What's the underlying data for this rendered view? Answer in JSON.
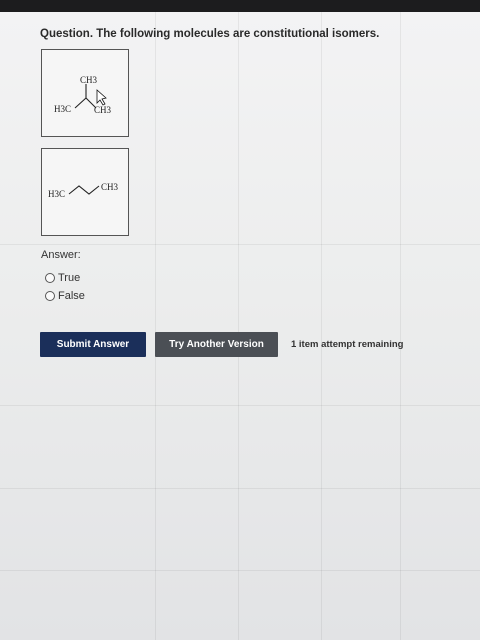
{
  "question": "Question. The following molecules are constitutional isomers.",
  "molecule_1": {
    "labels": {
      "top": "CH3",
      "left": "H3C",
      "right": "CH3"
    }
  },
  "molecule_2": {
    "labels": {
      "left": "H3C",
      "right": "CH3"
    }
  },
  "answer": {
    "label": "Answer:",
    "options": [
      {
        "label": "True",
        "selected": false
      },
      {
        "label": "False",
        "selected": false
      }
    ]
  },
  "buttons": {
    "submit": "Submit Answer",
    "try_another": "Try Another Version"
  },
  "attempts_text": "1 item attempt remaining",
  "colors": {
    "submit_button": "#1b2f5a",
    "try_button": "#4b4f55",
    "top_bar": "#1c1c1e"
  }
}
